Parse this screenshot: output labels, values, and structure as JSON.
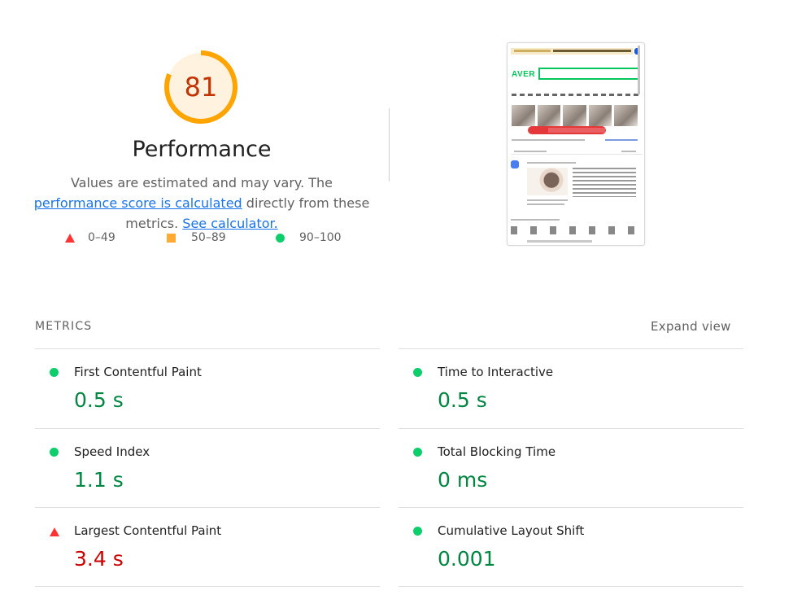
{
  "score": {
    "value": "81",
    "title": "Performance",
    "ring_color": "#ffa400",
    "ring_track": "#fff3e0",
    "value_color": "#c33300",
    "fraction": 0.81
  },
  "disclaimer": {
    "prefix": "Values are estimated and may vary. The ",
    "link1": "performance score is calculated",
    "middle": " directly from these metrics. ",
    "link2": "See calculator."
  },
  "legend": [
    {
      "shape": "triangle-icon",
      "label": "0–49",
      "color": "#ff3333"
    },
    {
      "shape": "square-icon",
      "label": "50–89",
      "color": "#ffaa33"
    },
    {
      "shape": "circle-icon",
      "label": "90–100",
      "color": "#0cce6b"
    }
  ],
  "screenshot": {
    "logo": "AVER"
  },
  "metrics_header": {
    "title": "METRICS",
    "expand_label": "Expand view"
  },
  "metrics": [
    {
      "name": "First Contentful Paint",
      "value": "0.5 s",
      "status": "pass"
    },
    {
      "name": "Time to Interactive",
      "value": "0.5 s",
      "status": "pass"
    },
    {
      "name": "Speed Index",
      "value": "1.1 s",
      "status": "pass"
    },
    {
      "name": "Total Blocking Time",
      "value": "0 ms",
      "status": "pass"
    },
    {
      "name": "Largest Contentful Paint",
      "value": "3.4 s",
      "status": "fail"
    },
    {
      "name": "Cumulative Layout Shift",
      "value": "0.001",
      "status": "pass"
    }
  ]
}
